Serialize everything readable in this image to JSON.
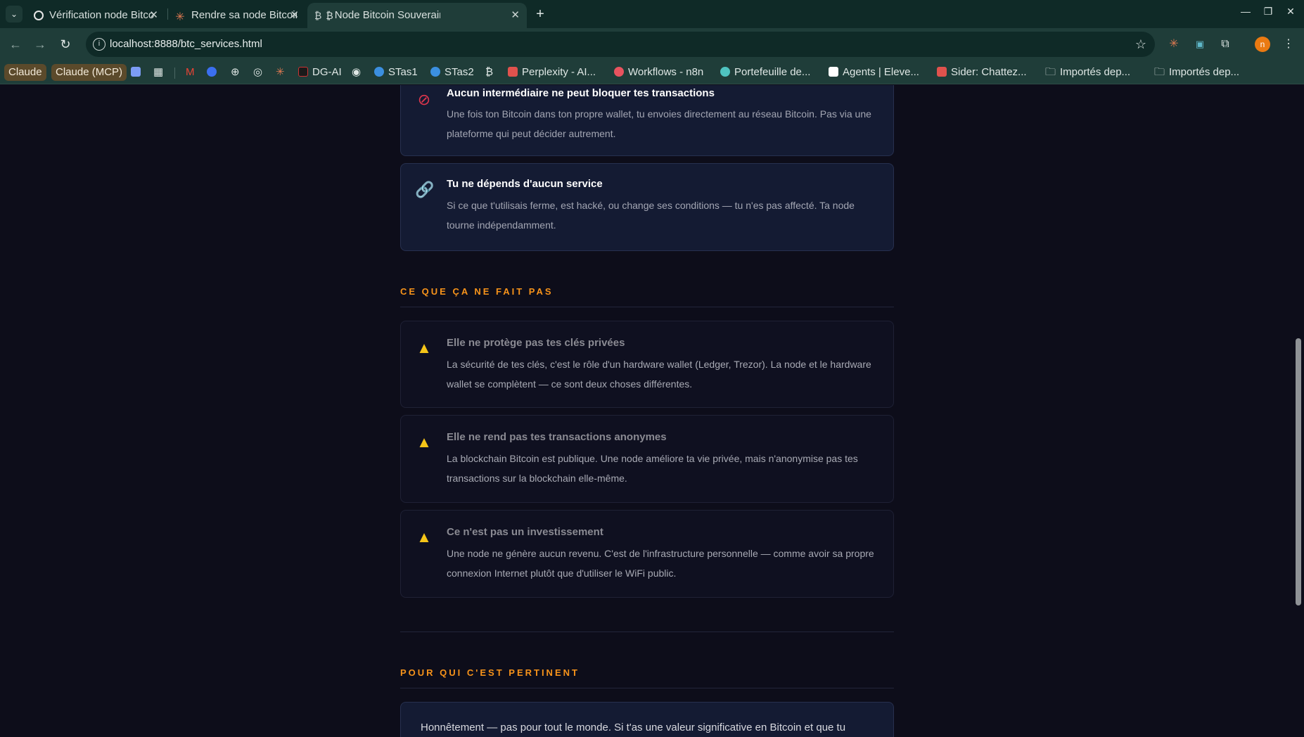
{
  "browser": {
    "tabs": [
      {
        "label": "Vérification node Bitcoin",
        "icon": "openai-icon"
      },
      {
        "label": "Rendre sa node Bitcoin p",
        "icon": "claude-icon"
      },
      {
        "label": "Node Bitcoin Souverain",
        "icon": "bitcoin-icon",
        "prefix": "₿"
      }
    ],
    "url": "localhost:8888/btc_services.html",
    "profile_initial": "n",
    "bookmarks": [
      {
        "label": "Claude",
        "style": "pill"
      },
      {
        "label": "Claude (MCP)",
        "style": "pill"
      },
      {
        "label": "DG-AI"
      },
      {
        "label": "STas1"
      },
      {
        "label": "STas2"
      },
      {
        "label": "Perplexity - AI..."
      },
      {
        "label": "Workflows - n8n"
      },
      {
        "label": "Portefeuille de..."
      },
      {
        "label": "Agents | Eleve..."
      },
      {
        "label": "Sider: Chattez..."
      },
      {
        "label": "Importés dep..."
      },
      {
        "label": "Importés dep..."
      }
    ]
  },
  "positives": [
    {
      "icon": "🚫",
      "title": "Aucun intermédiaire ne peut bloquer tes transactions",
      "desc": "Une fois ton Bitcoin dans ton propre wallet, tu envoies directement au réseau Bitcoin. Pas via une plateforme qui peut décider autrement."
    },
    {
      "icon": "🔗",
      "title": "Tu ne dépends d'aucun service",
      "desc": "Si ce que t'utilisais ferme, est hacké, ou change ses conditions — tu n'es pas affecté. Ta node tourne indépendamment."
    }
  ],
  "section_not": {
    "title": "CE QUE ÇA NE FAIT PAS",
    "items": [
      {
        "icon": "⚠️",
        "title": "Elle ne protège pas tes clés privées",
        "desc": "La sécurité de tes clés, c'est le rôle d'un hardware wallet (Ledger, Trezor). La node et le hardware wallet se complètent — ce sont deux choses différentes."
      },
      {
        "icon": "⚠️",
        "title": "Elle ne rend pas tes transactions anonymes",
        "desc": "La blockchain Bitcoin est publique. Une node améliore ta vie privée, mais n'anonymise pas tes transactions sur la blockchain elle-même."
      },
      {
        "icon": "⚠️",
        "title": "Ce n'est pas un investissement",
        "desc": "Une node ne génère aucun revenu. C'est de l'infrastructure personnelle — comme avoir sa propre connexion Internet plutôt que d'utiliser le WiFi public."
      }
    ]
  },
  "section_for_whom": {
    "title": "POUR QUI C'EST PERTINENT",
    "text": "Honnêtement — pas pour tout le monde. Si t'as une valeur significative en Bitcoin et que tu"
  },
  "colors": {
    "accent": "#f7931a",
    "background": "#0d0d1a",
    "card_positive": "#141b33",
    "card_negative": "#0f1020",
    "warning": "#f5c518",
    "danger": "#e0364d"
  }
}
